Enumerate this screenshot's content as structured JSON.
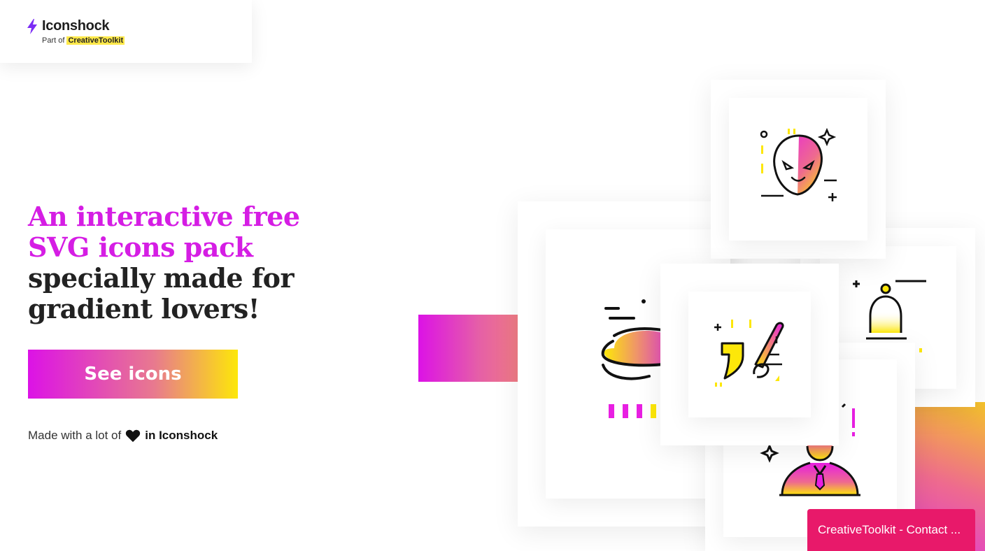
{
  "header": {
    "brand": "Iconshock",
    "sub_prefix": "Part of",
    "sub_highlight": "CreativeToolkit"
  },
  "hero": {
    "title_accent_1": "An interactive free",
    "title_accent_2": "SVG icons pack",
    "title_plain_1": "specially made for",
    "title_plain_2": "gradient lovers!",
    "cta_label": "See icons"
  },
  "footer_note": {
    "prefix": "Made with a lot of",
    "icon": "heart-icon",
    "suffix": "in Iconshock"
  },
  "showcase": {
    "icons": [
      "alien-icon",
      "ufo-icon",
      "paint-brush-icon",
      "bell-icon",
      "person-icon"
    ]
  },
  "contact_button": {
    "label": "CreativeToolkit - Contact ..."
  },
  "colors": {
    "accent": "#d51de4",
    "gradient_start": "#dc12e6",
    "gradient_end": "#fde709",
    "highlight": "#ffe94a",
    "contact_bg": "#e8196a"
  }
}
